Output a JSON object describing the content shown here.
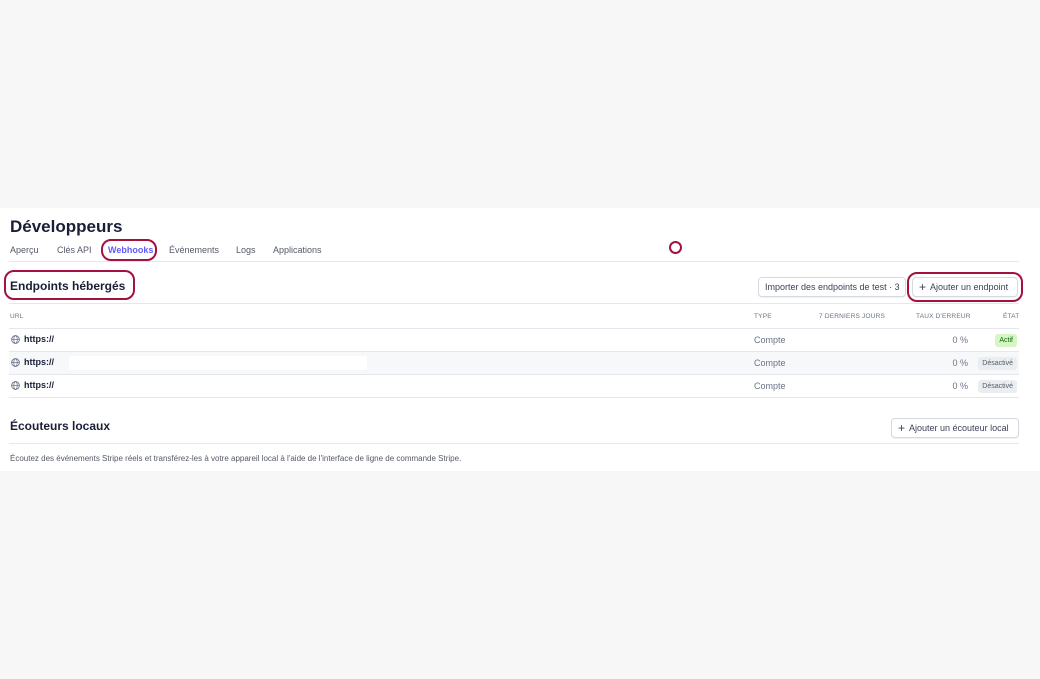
{
  "page": {
    "title": "Développeurs"
  },
  "tabs": [
    {
      "label": "Aperçu",
      "active": false
    },
    {
      "label": "Clés API",
      "active": false
    },
    {
      "label": "Webhooks",
      "active": true
    },
    {
      "label": "Événements",
      "active": false
    },
    {
      "label": "Logs",
      "active": false
    },
    {
      "label": "Applications",
      "active": false
    }
  ],
  "hosted": {
    "title": "Endpoints hébergés",
    "import_button": "Importer des endpoints de test · 3",
    "add_button": "Ajouter un endpoint",
    "columns": {
      "url": "URL",
      "type": "TYPE",
      "last7": "7 DERNIERS JOURS",
      "error_rate": "TAUX D'ERREUR",
      "state": "ÉTAT"
    },
    "rows": [
      {
        "url": "https://",
        "type": "Compte",
        "error_rate": "0 %",
        "state": "Actif",
        "active": true
      },
      {
        "url": "https://",
        "type": "Compte",
        "error_rate": "0 %",
        "state": "Désactivé",
        "active": false
      },
      {
        "url": "https://",
        "type": "Compte",
        "error_rate": "0 %",
        "state": "Désactivé",
        "active": false
      }
    ]
  },
  "listeners": {
    "title": "Écouteurs locaux",
    "add_button": "Ajouter un écouteur local",
    "description": "Écoutez des événements Stripe réels et transférez-les à votre appareil local à l'aide de l'interface de ligne de commande Stripe."
  },
  "colors": {
    "highlight": "#a3123f",
    "accent": "#635bff",
    "active_badge": "#d7f7c2",
    "inactive_badge": "#ebeef1"
  }
}
